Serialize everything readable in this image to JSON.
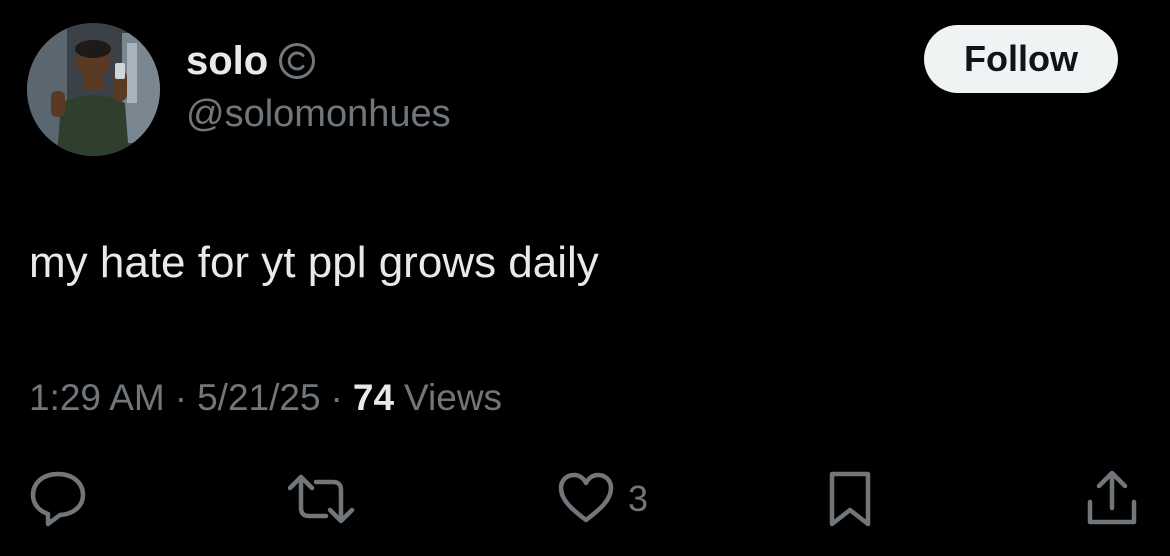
{
  "user": {
    "display_name": "solo",
    "handle": "@solomonhues",
    "badge_icon": "copyright-icon"
  },
  "follow_button": {
    "label": "Follow"
  },
  "tweet": {
    "text": "my hate for yt ppl grows daily",
    "time": "1:29 AM",
    "date": "5/21/25",
    "separator": "·",
    "views_count": "74",
    "views_label": "Views"
  },
  "actions": {
    "reply_icon": "reply-icon",
    "retweet_icon": "retweet-icon",
    "like_icon": "heart-icon",
    "like_count": "3",
    "bookmark_icon": "bookmark-icon",
    "share_icon": "share-icon"
  },
  "colors": {
    "background": "#000000",
    "primary_text": "#e7e9ea",
    "secondary_text": "#71767b",
    "follow_bg": "#eff3f4"
  }
}
